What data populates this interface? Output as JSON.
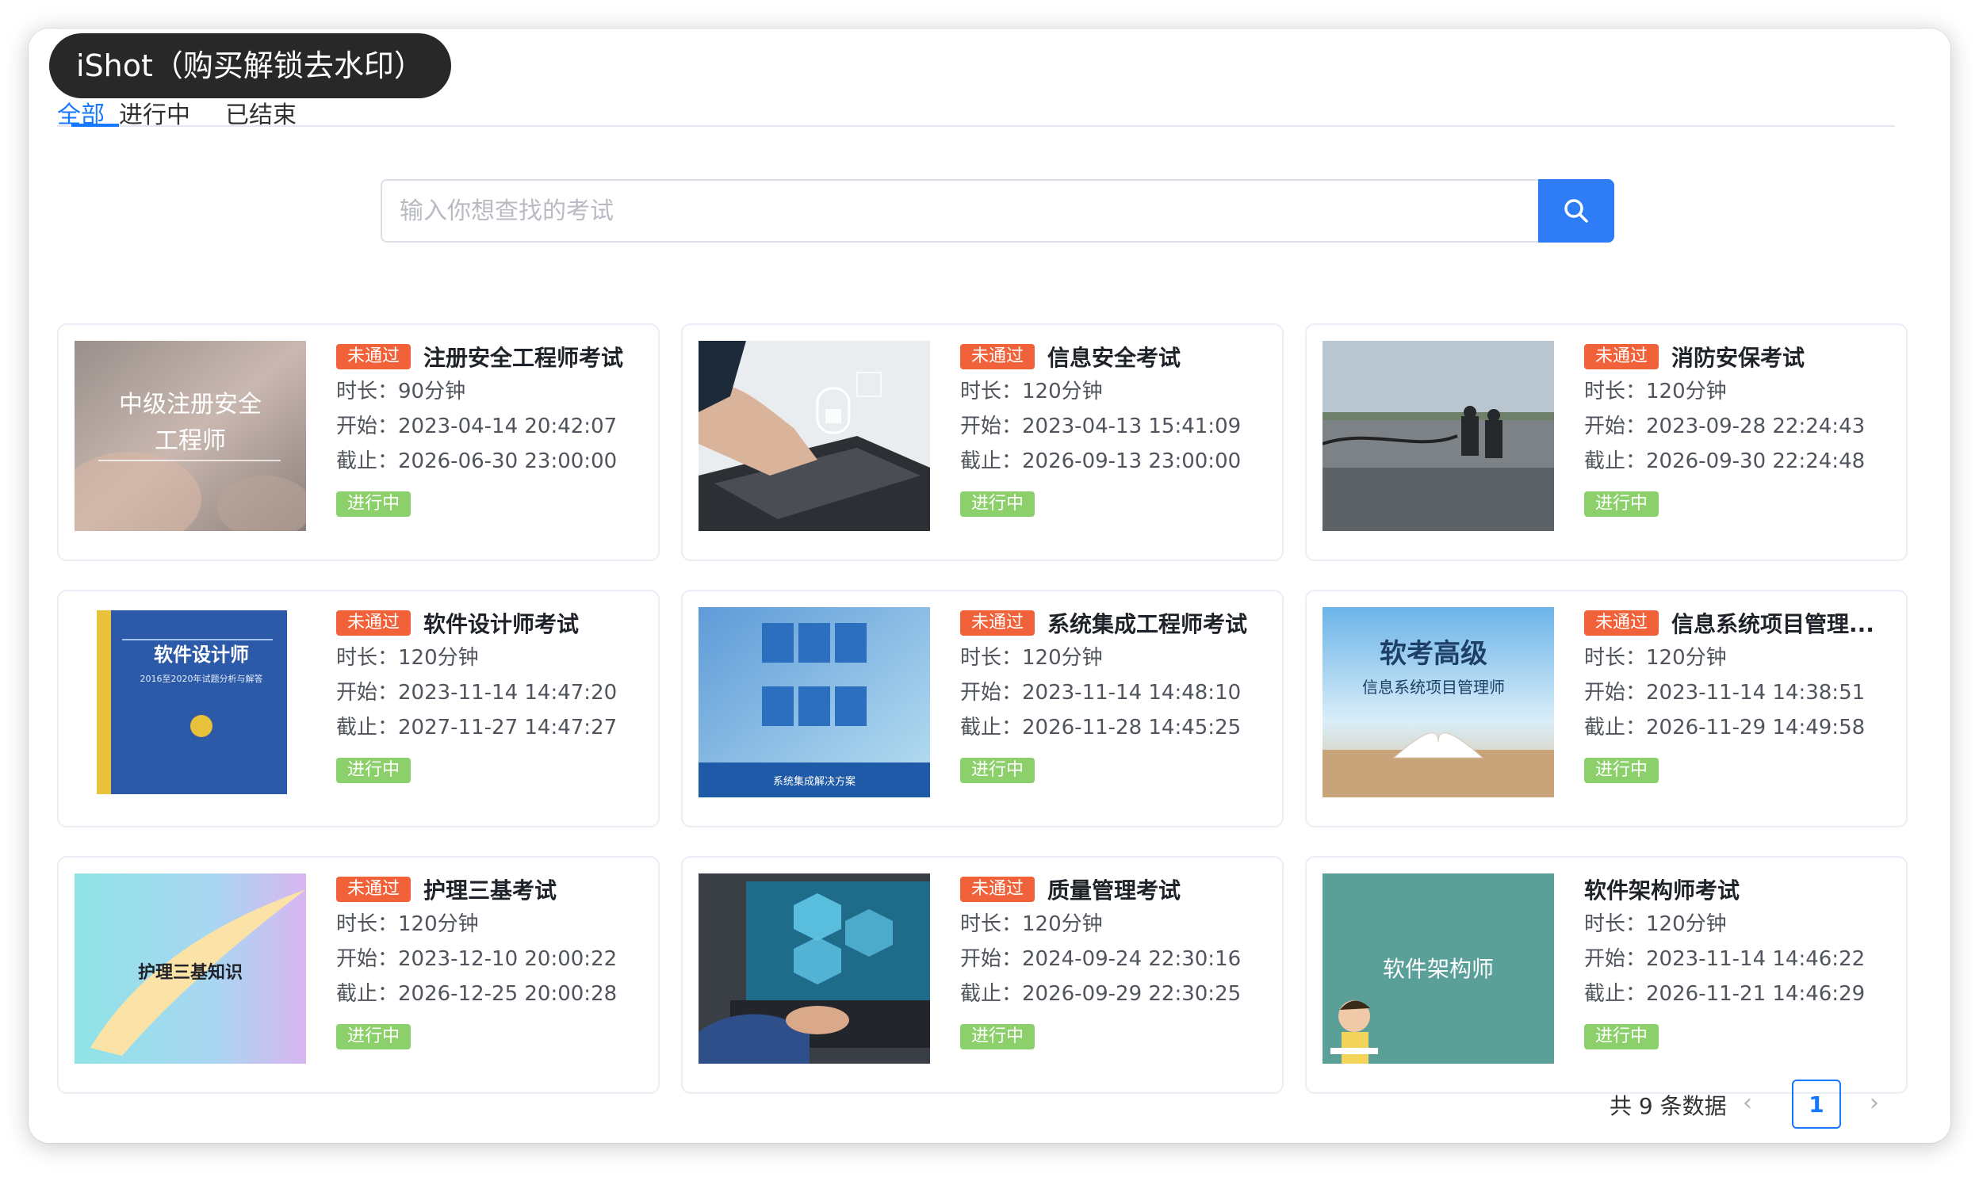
{
  "watermark": "iShot（购买解锁去水印）",
  "tabs": [
    {
      "label": "全部"
    },
    {
      "label": "进行中"
    },
    {
      "label": "已结束"
    }
  ],
  "search": {
    "placeholder": "输入你想查找的考试"
  },
  "labels": {
    "duration": "时长：",
    "start": "开始：",
    "end": "截止："
  },
  "colors": {
    "accent": "#1677ff",
    "fail_tag": "#f2623a",
    "status_tag": "#8bd06a"
  },
  "exams": [
    {
      "tag": "未通过",
      "title": "注册安全工程师考试",
      "duration": "90分钟",
      "start": "2023-04-14 20:42:07",
      "end": "2026-06-30 23:00:00",
      "status": "进行中",
      "thumb_text": [
        "中级注册安全",
        "工程师"
      ]
    },
    {
      "tag": "未通过",
      "title": "信息安全考试",
      "duration": "120分钟",
      "start": "2023-04-13 15:41:09",
      "end": "2026-09-13 23:00:00",
      "status": "进行中"
    },
    {
      "tag": "未通过",
      "title": "消防安保考试",
      "duration": "120分钟",
      "start": "2023-09-28 22:24:43",
      "end": "2026-09-30 22:24:48",
      "status": "进行中"
    },
    {
      "tag": "未通过",
      "title": "软件设计师考试",
      "duration": "120分钟",
      "start": "2023-11-14 14:47:20",
      "end": "2027-11-27 14:47:27",
      "status": "进行中",
      "thumb_text": [
        "软件设计师",
        "2016至2020年试题分析与解答"
      ]
    },
    {
      "tag": "未通过",
      "title": "系统集成工程师考试",
      "duration": "120分钟",
      "start": "2023-11-14 14:48:10",
      "end": "2026-11-28 14:45:25",
      "status": "进行中",
      "thumb_text": [
        "系统集成解决方案"
      ]
    },
    {
      "tag": "未通过",
      "title": "信息系统项目管理...",
      "duration": "120分钟",
      "start": "2023-11-14 14:38:51",
      "end": "2026-11-29 14:49:58",
      "status": "进行中",
      "thumb_text": [
        "软考高级",
        "信息系统项目管理师"
      ]
    },
    {
      "tag": "未通过",
      "title": "护理三基考试",
      "duration": "120分钟",
      "start": "2023-12-10 20:00:22",
      "end": "2026-12-25 20:00:28",
      "status": "进行中",
      "thumb_text": [
        "护理三基知识"
      ]
    },
    {
      "tag": "未通过",
      "title": "质量管理考试",
      "duration": "120分钟",
      "start": "2024-09-24 22:30:16",
      "end": "2026-09-29 22:30:25",
      "status": "进行中"
    },
    {
      "tag": "",
      "title": "软件架构师考试",
      "duration": "120分钟",
      "start": "2023-11-14 14:46:22",
      "end": "2026-11-21 14:46:29",
      "status": "进行中",
      "thumb_text": [
        "软件架构师"
      ]
    }
  ],
  "pagination": {
    "total_text": "共 9 条数据",
    "current_page": "1",
    "prev_icon": "chevron-left-icon",
    "next_icon": "chevron-right-icon"
  }
}
